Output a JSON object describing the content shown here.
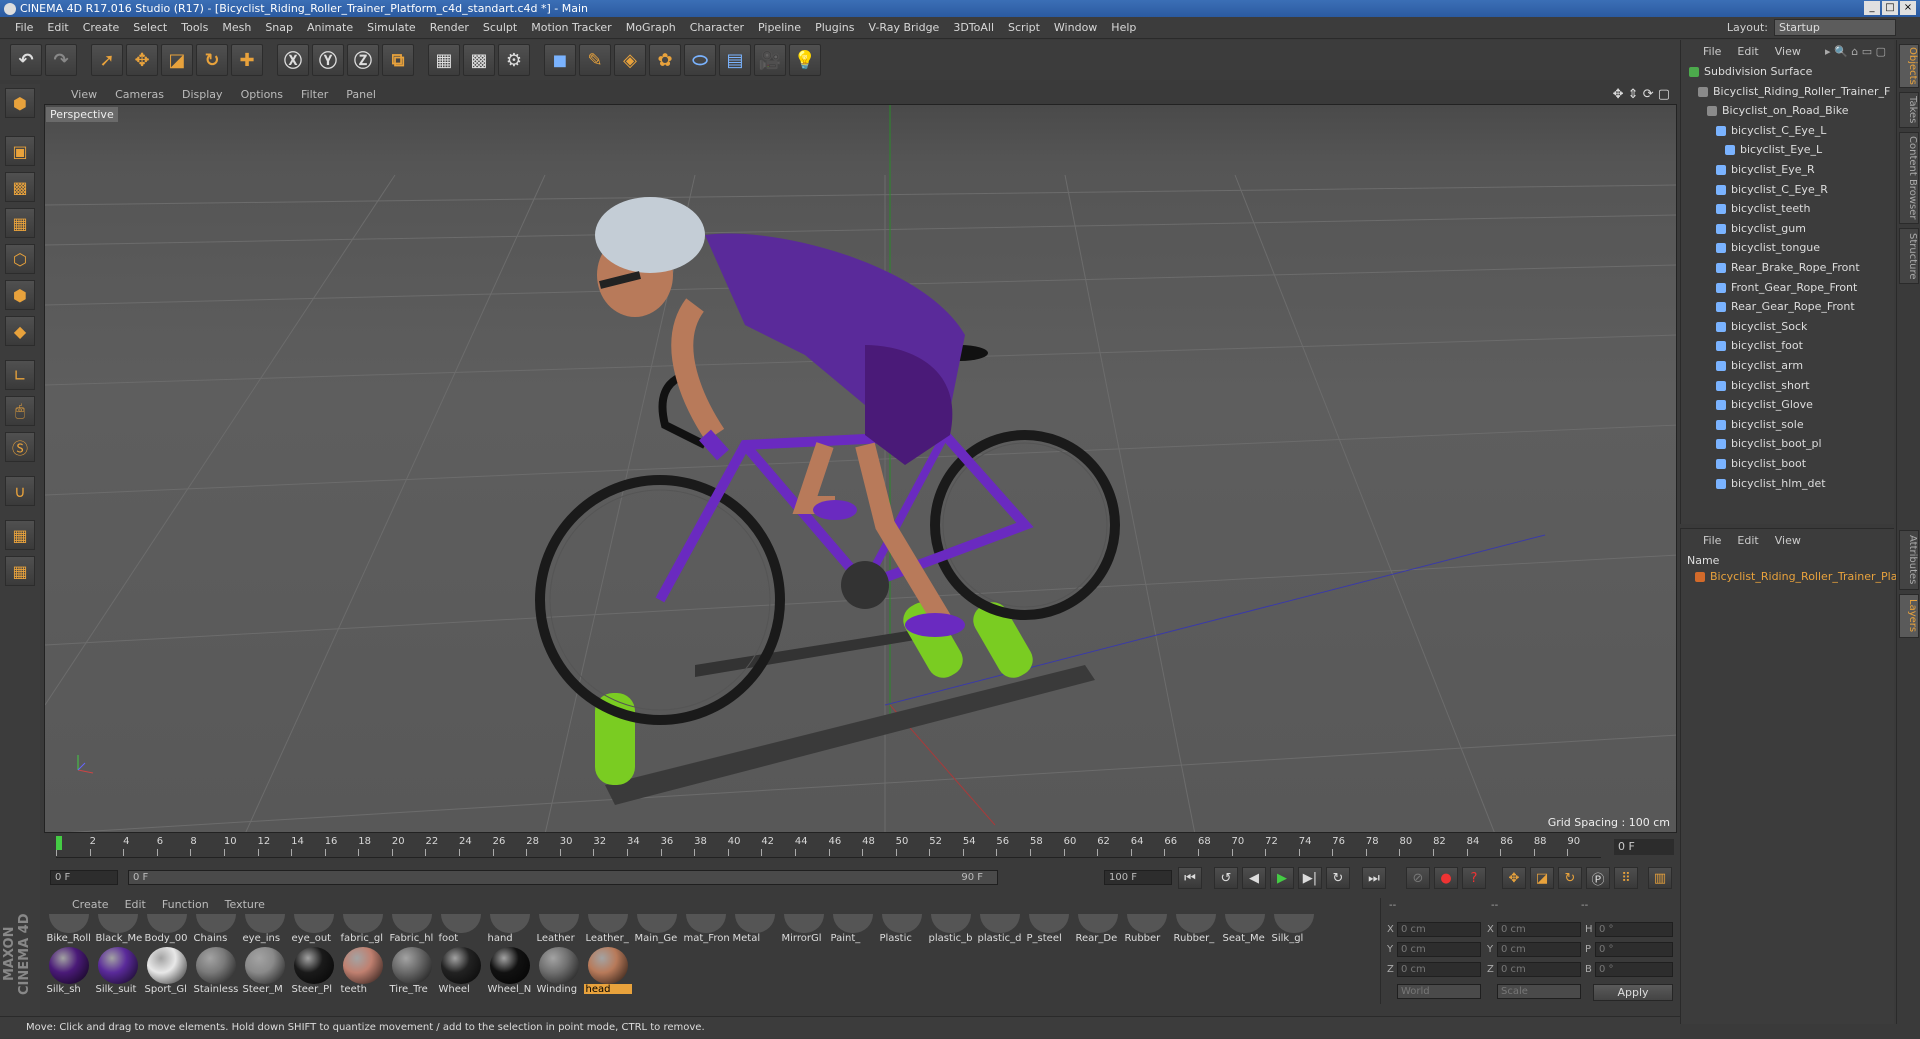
{
  "window": {
    "title": "CINEMA 4D R17.016 Studio (R17) - [Bicyclist_Riding_Roller_Trainer_Platform_c4d_standart.c4d *] - Main"
  },
  "menu": [
    "File",
    "Edit",
    "Create",
    "Select",
    "Tools",
    "Mesh",
    "Snap",
    "Animate",
    "Simulate",
    "Render",
    "Sculpt",
    "Motion Tracker",
    "MoGraph",
    "Character",
    "Pipeline",
    "Plugins",
    "V-Ray Bridge",
    "3DToAll",
    "Script",
    "Window",
    "Help"
  ],
  "layout": {
    "label": "Layout:",
    "value": "Startup"
  },
  "viewport_menu": [
    "View",
    "Cameras",
    "Display",
    "Options",
    "Filter",
    "Panel"
  ],
  "viewport": {
    "label": "Perspective",
    "grid_spacing": "Grid Spacing : 100 cm"
  },
  "timeline": {
    "ticks": [
      "0",
      "2",
      "4",
      "6",
      "8",
      "10",
      "12",
      "14",
      "16",
      "18",
      "20",
      "22",
      "24",
      "26",
      "28",
      "30",
      "32",
      "34",
      "36",
      "38",
      "40",
      "42",
      "44",
      "46",
      "48",
      "50",
      "52",
      "54",
      "56",
      "58",
      "60",
      "62",
      "64",
      "66",
      "68",
      "70",
      "72",
      "74",
      "76",
      "78",
      "80",
      "82",
      "84",
      "86",
      "88",
      "90"
    ],
    "current_frame": "0 F",
    "start_field": "0 F",
    "range_start": "0 F",
    "range_end": "90 F",
    "end_field": "100 F"
  },
  "material_menu": [
    "Create",
    "Edit",
    "Function",
    "Texture"
  ],
  "materials_row1": [
    "Bike_Roll",
    "Black_Me",
    "Body_00",
    "Chains",
    "eye_ins",
    "eye_out",
    "fabric_gl",
    "Fabric_hl",
    "foot",
    "hand",
    "Leather",
    "Leather_",
    "Main_Ge",
    "mat_Fron",
    "Metal",
    "MirrorGl",
    "Paint_",
    "Plastic",
    "plastic_b",
    "plastic_d",
    "P_steel",
    "Rear_De",
    "Rubber",
    "Rubber_",
    "Seat_Me",
    "Silk_gl"
  ],
  "materials_row2": [
    {
      "name": "Silk_sh",
      "color": "#4a1a78"
    },
    {
      "name": "Silk_suit",
      "color": "#5a2a9a"
    },
    {
      "name": "Sport_Gl",
      "color": "#e8e8e8"
    },
    {
      "name": "Stainless",
      "color": "#7a7a7a"
    },
    {
      "name": "Steer_M",
      "color": "#8a8a8a"
    },
    {
      "name": "Steer_Pl",
      "color": "#1a1a1a"
    },
    {
      "name": "teeth",
      "color": "#c08070"
    },
    {
      "name": "Tire_Tre",
      "color": "#6a6a6a"
    },
    {
      "name": "Wheel",
      "color": "#222222"
    },
    {
      "name": "Wheel_N",
      "color": "#111111"
    },
    {
      "name": "Winding",
      "color": "#707070"
    },
    {
      "name": "head",
      "color": "#b87a5a"
    }
  ],
  "selected_material": "head",
  "coords": {
    "header_left": "--",
    "header_mid": "--",
    "header_right": "--",
    "rows": [
      {
        "a": "X",
        "av": "0 cm",
        "b": "X",
        "bv": "0 cm",
        "c": "H",
        "cv": "0 °"
      },
      {
        "a": "Y",
        "av": "0 cm",
        "b": "Y",
        "bv": "0 cm",
        "c": "P",
        "cv": "0 °"
      },
      {
        "a": "Z",
        "av": "0 cm",
        "b": "Z",
        "bv": "0 cm",
        "c": "B",
        "cv": "0 °"
      }
    ],
    "mode1": "World",
    "mode2": "Scale",
    "apply": "Apply"
  },
  "objects_menu": [
    "File",
    "Edit",
    "View"
  ],
  "objects": [
    {
      "name": "Subdivision Surface",
      "indent": 0
    },
    {
      "name": "Bicyclist_Riding_Roller_Trainer_F",
      "indent": 1
    },
    {
      "name": "Bicyclist_on_Road_Bike",
      "indent": 2
    },
    {
      "name": "bicyclist_C_Eye_L",
      "indent": 3
    },
    {
      "name": "bicyclist_Eye_L",
      "indent": 4
    },
    {
      "name": "bicyclist_Eye_R",
      "indent": 3
    },
    {
      "name": "bicyclist_C_Eye_R",
      "indent": 3
    },
    {
      "name": "bicyclist_teeth",
      "indent": 3
    },
    {
      "name": "bicyclist_gum",
      "indent": 3
    },
    {
      "name": "bicyclist_tongue",
      "indent": 3
    },
    {
      "name": "Rear_Brake_Rope_Front",
      "indent": 3
    },
    {
      "name": "Front_Gear_Rope_Front",
      "indent": 3
    },
    {
      "name": "Rear_Gear_Rope_Front",
      "indent": 3
    },
    {
      "name": "bicyclist_Sock",
      "indent": 3
    },
    {
      "name": "bicyclist_foot",
      "indent": 3
    },
    {
      "name": "bicyclist_arm",
      "indent": 3
    },
    {
      "name": "bicyclist_short",
      "indent": 3
    },
    {
      "name": "bicyclist_Glove",
      "indent": 3
    },
    {
      "name": "bicyclist_sole",
      "indent": 3
    },
    {
      "name": "bicyclist_boot_pl",
      "indent": 3
    },
    {
      "name": "bicyclist_boot",
      "indent": 3
    },
    {
      "name": "bicyclist_hlm_det",
      "indent": 3
    }
  ],
  "attr_menu": [
    "File",
    "Edit",
    "View"
  ],
  "attr_name_header": "Name",
  "attr_layer": "Bicyclist_Riding_Roller_Trainer_Platf",
  "side_tabs": [
    "Objects",
    "Takes",
    "Content Browser",
    "Structure",
    "Attributes",
    "Layers"
  ],
  "status": "Move: Click and drag to move elements. Hold down SHIFT to quantize movement / add to the selection in point mode, CTRL to remove.",
  "maxon": "MAXON CINEMA 4D",
  "colors": {
    "accent": "#e8a23c",
    "bg": "#3c3c3c",
    "purple": "#5a2a9a",
    "green": "#7acc22"
  }
}
